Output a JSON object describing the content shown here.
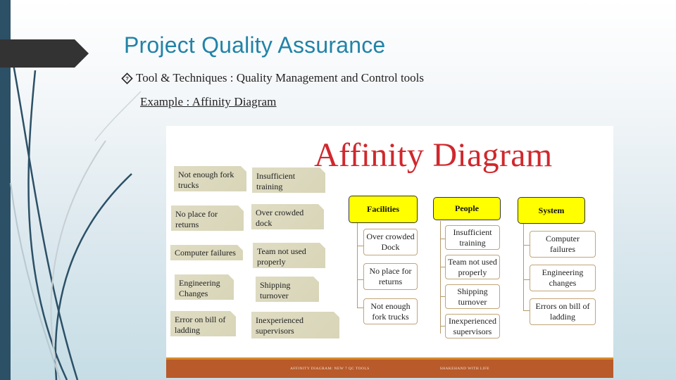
{
  "slide": {
    "title": "Project Quality Assurance",
    "bullet": {
      "icon": "question-diamond-icon",
      "text": "Tool & Techniques : Quality Management and Control tools"
    },
    "example_link": "Example : Affinity Diagram"
  },
  "figure": {
    "title": "Affinity Diagram",
    "sticky_notes": [
      "Not enough fork trucks",
      "Insufficient training",
      "No place for returns",
      "Over crowded dock",
      "Computer failures",
      "Team not used properly",
      "Engineering Changes",
      "Shipping turnover",
      "Error on bill of ladding",
      "Inexperienced supervisors"
    ],
    "categories": [
      {
        "name": "Facilities",
        "items": [
          "Over crowded Dock",
          "No place for returns",
          "Not enough fork trucks"
        ]
      },
      {
        "name": "People",
        "items": [
          "Insufficient training",
          "Team not used properly",
          "Shipping turnover",
          "Inexperienced supervisors"
        ]
      },
      {
        "name": "System",
        "items": [
          "Computer failures",
          "Engineering changes",
          "Errors on bill of ladding"
        ]
      }
    ],
    "footer": {
      "left": "AFFINITY DIAGRAM: NEW 7 QC TOOLS",
      "right": "SHAKEHAND WITH LIFE"
    },
    "colors": {
      "title": "#d0282d",
      "header_fill": "#ffff00",
      "note_fill": "#dcd9bd",
      "footer": "#b85a2a"
    }
  },
  "theme": {
    "title_color": "#2183a8",
    "sidebar_color": "#2c5066",
    "banner_color": "#333333"
  }
}
